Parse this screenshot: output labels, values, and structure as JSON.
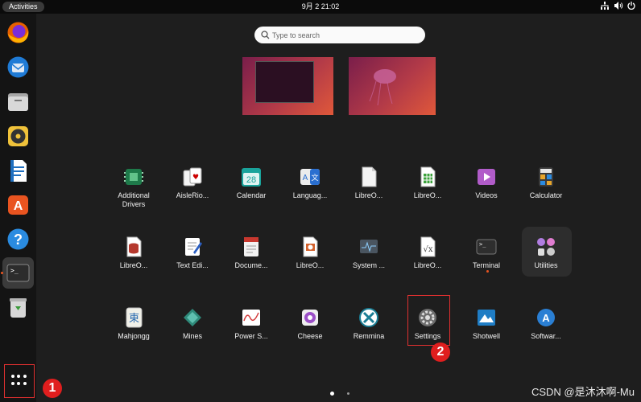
{
  "topbar": {
    "activities": "Activities",
    "clock": "9月 2  21:02",
    "network_icon": "network-icon",
    "volume_icon": "volume-icon",
    "power_icon": "power-icon"
  },
  "search": {
    "placeholder": "Type to search"
  },
  "dock": {
    "items": [
      "firefox",
      "thunderbird",
      "files",
      "rhythmbox",
      "libreoffice-writer",
      "app-center",
      "help",
      "terminal",
      "trash"
    ],
    "show_apps_callout": "1"
  },
  "apps": [
    {
      "label": "Additional\nDrivers",
      "icon": "chip-icon"
    },
    {
      "label": "AisleRio...",
      "icon": "cards-icon"
    },
    {
      "label": "Calendar",
      "icon": "calendar-icon"
    },
    {
      "label": "Languag...",
      "icon": "language-icon"
    },
    {
      "label": "LibreO...",
      "icon": "libreoffice-icon"
    },
    {
      "label": "LibreO...",
      "icon": "libreoffice-calc-icon"
    },
    {
      "label": "Videos",
      "icon": "videos-icon"
    },
    {
      "label": "Calculator",
      "icon": "calculator-icon"
    },
    {
      "label": "LibreO...",
      "icon": "libreoffice-base-icon"
    },
    {
      "label": "Text Edi...",
      "icon": "text-editor-icon"
    },
    {
      "label": "Docume...",
      "icon": "document-viewer-icon"
    },
    {
      "label": "LibreO...",
      "icon": "libreoffice-impress-icon"
    },
    {
      "label": "System ...",
      "icon": "system-monitor-icon"
    },
    {
      "label": "LibreO...",
      "icon": "libreoffice-math-icon"
    },
    {
      "label": "Terminal",
      "icon": "terminal-icon"
    },
    {
      "label": "Utilities",
      "icon": "utilities-folder-icon"
    },
    {
      "label": "Mahjongg",
      "icon": "mahjongg-icon"
    },
    {
      "label": "Mines",
      "icon": "mines-icon"
    },
    {
      "label": "Power S...",
      "icon": "power-statistics-icon"
    },
    {
      "label": "Cheese",
      "icon": "cheese-icon"
    },
    {
      "label": "Remmina",
      "icon": "remmina-icon"
    },
    {
      "label": "Settings",
      "icon": "settings-icon"
    },
    {
      "label": "Shotwell",
      "icon": "shotwell-icon"
    },
    {
      "label": "Softwar...",
      "icon": "software-icon"
    }
  ],
  "settings_callout": "2",
  "watermark": "CSDN @是沐沐啊-Mu",
  "colors": {
    "accent": "#e95420",
    "highlight": "#e03030",
    "background": "#1e1e1e"
  }
}
